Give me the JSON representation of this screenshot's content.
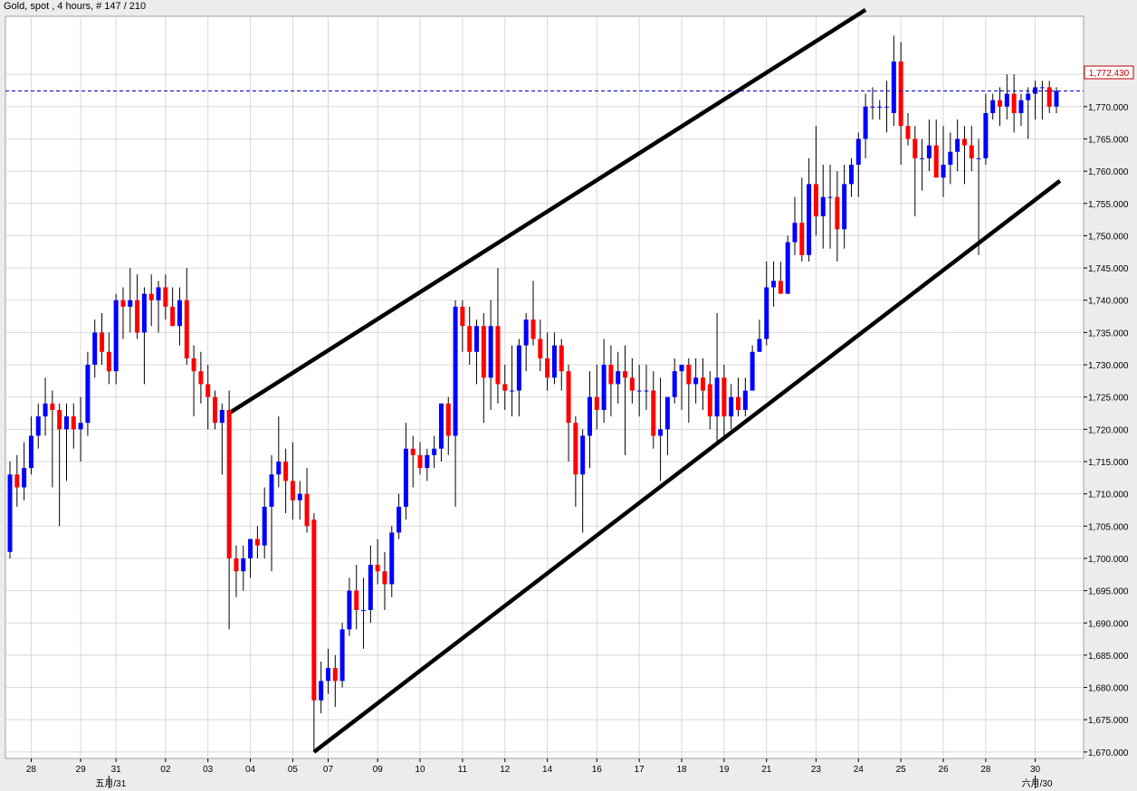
{
  "header": {
    "title": "Gold, spot , 4 hours, # 147 / 210"
  },
  "colors": {
    "up": "#0000ff",
    "down": "#ff0000",
    "grid": "#d8d8d8",
    "channel": "#000000",
    "last_price_line": "#0000cc",
    "last_price_label": "#c00000"
  },
  "chart_data": {
    "type": "candlestick",
    "ylim": [
      1669,
      1784
    ],
    "yticks": [
      1670,
      1675,
      1680,
      1685,
      1690,
      1695,
      1700,
      1705,
      1710,
      1715,
      1720,
      1725,
      1730,
      1735,
      1740,
      1745,
      1750,
      1755,
      1760,
      1765,
      1770,
      1775
    ],
    "xticks": [
      {
        "label": "28",
        "i": 3
      },
      {
        "label": "29",
        "i": 10
      },
      {
        "label": "31",
        "i": 15
      },
      {
        "label": "02",
        "i": 22
      },
      {
        "label": "03",
        "i": 28
      },
      {
        "label": "04",
        "i": 34
      },
      {
        "label": "05",
        "i": 40
      },
      {
        "label": "07",
        "i": 45
      },
      {
        "label": "09",
        "i": 52
      },
      {
        "label": "10",
        "i": 58
      },
      {
        "label": "11",
        "i": 64
      },
      {
        "label": "12",
        "i": 70
      },
      {
        "label": "14",
        "i": 76
      },
      {
        "label": "16",
        "i": 83
      },
      {
        "label": "17",
        "i": 89
      },
      {
        "label": "18",
        "i": 95
      },
      {
        "label": "19",
        "i": 101
      },
      {
        "label": "21",
        "i": 107
      },
      {
        "label": "23",
        "i": 114
      },
      {
        "label": "24",
        "i": 120
      },
      {
        "label": "25",
        "i": 126
      },
      {
        "label": "26",
        "i": 132
      },
      {
        "label": "28",
        "i": 138
      },
      {
        "label": "30",
        "i": 145
      }
    ],
    "month_labels": [
      {
        "label": "五月/31",
        "i": 14
      },
      {
        "label": "六月/30",
        "i": 145
      }
    ],
    "last_price": 1772.43,
    "last_price_label": "1,772.430",
    "trendlines": [
      {
        "name": "upper-channel-line",
        "from": {
          "i": 31,
          "y": 1722.5
        },
        "to": {
          "i": 121,
          "y": 1785
        }
      },
      {
        "name": "lower-channel-line",
        "from": {
          "i": 43,
          "y": 1670
        },
        "to": {
          "i": 148.5,
          "y": 1758.5
        }
      }
    ],
    "candles": [
      {
        "o": 1701,
        "h": 1715,
        "l": 1700,
        "c": 1713
      },
      {
        "o": 1713,
        "h": 1716,
        "l": 1708,
        "c": 1711
      },
      {
        "o": 1711,
        "h": 1718,
        "l": 1709,
        "c": 1714
      },
      {
        "o": 1714,
        "h": 1722,
        "l": 1713,
        "c": 1719
      },
      {
        "o": 1719,
        "h": 1724,
        "l": 1717,
        "c": 1722
      },
      {
        "o": 1722,
        "h": 1728,
        "l": 1719,
        "c": 1724
      },
      {
        "o": 1724,
        "h": 1726,
        "l": 1711,
        "c": 1723
      },
      {
        "o": 1723,
        "h": 1724,
        "l": 1705,
        "c": 1720
      },
      {
        "o": 1720,
        "h": 1724,
        "l": 1712,
        "c": 1722
      },
      {
        "o": 1722,
        "h": 1724,
        "l": 1717,
        "c": 1720
      },
      {
        "o": 1720,
        "h": 1725,
        "l": 1715,
        "c": 1721
      },
      {
        "o": 1721,
        "h": 1732,
        "l": 1719,
        "c": 1730
      },
      {
        "o": 1730,
        "h": 1737,
        "l": 1728,
        "c": 1735
      },
      {
        "o": 1735,
        "h": 1738,
        "l": 1730,
        "c": 1732
      },
      {
        "o": 1732,
        "h": 1735,
        "l": 1727,
        "c": 1729
      },
      {
        "o": 1729,
        "h": 1741,
        "l": 1727,
        "c": 1740
      },
      {
        "o": 1740,
        "h": 1742,
        "l": 1734,
        "c": 1739
      },
      {
        "o": 1739,
        "h": 1745,
        "l": 1735,
        "c": 1740
      },
      {
        "o": 1740,
        "h": 1744,
        "l": 1734,
        "c": 1735
      },
      {
        "o": 1735,
        "h": 1742,
        "l": 1727,
        "c": 1741
      },
      {
        "o": 1741,
        "h": 1744,
        "l": 1736,
        "c": 1740
      },
      {
        "o": 1740,
        "h": 1743,
        "l": 1735,
        "c": 1742
      },
      {
        "o": 1742,
        "h": 1744,
        "l": 1737,
        "c": 1739
      },
      {
        "o": 1739,
        "h": 1742,
        "l": 1736,
        "c": 1736
      },
      {
        "o": 1736,
        "h": 1742,
        "l": 1733,
        "c": 1740
      },
      {
        "o": 1740,
        "h": 1745,
        "l": 1730,
        "c": 1731
      },
      {
        "o": 1731,
        "h": 1733,
        "l": 1722,
        "c": 1729
      },
      {
        "o": 1729,
        "h": 1732,
        "l": 1724,
        "c": 1727
      },
      {
        "o": 1727,
        "h": 1730,
        "l": 1720,
        "c": 1725
      },
      {
        "o": 1725,
        "h": 1726,
        "l": 1720,
        "c": 1721
      },
      {
        "o": 1721,
        "h": 1724,
        "l": 1713,
        "c": 1723
      },
      {
        "o": 1723,
        "h": 1726,
        "l": 1689,
        "c": 1700
      },
      {
        "o": 1700,
        "h": 1702,
        "l": 1694,
        "c": 1698
      },
      {
        "o": 1698,
        "h": 1702,
        "l": 1695,
        "c": 1700
      },
      {
        "o": 1700,
        "h": 1703,
        "l": 1697,
        "c": 1703
      },
      {
        "o": 1703,
        "h": 1705,
        "l": 1700,
        "c": 1702
      },
      {
        "o": 1702,
        "h": 1711,
        "l": 1700,
        "c": 1708
      },
      {
        "o": 1708,
        "h": 1716,
        "l": 1698,
        "c": 1713
      },
      {
        "o": 1713,
        "h": 1722,
        "l": 1711,
        "c": 1715
      },
      {
        "o": 1715,
        "h": 1717,
        "l": 1707,
        "c": 1712
      },
      {
        "o": 1712,
        "h": 1718,
        "l": 1706,
        "c": 1709
      },
      {
        "o": 1709,
        "h": 1712,
        "l": 1706,
        "c": 1710
      },
      {
        "o": 1710,
        "h": 1714,
        "l": 1704,
        "c": 1705
      },
      {
        "o": 1706,
        "h": 1707,
        "l": 1670,
        "c": 1678
      },
      {
        "o": 1678,
        "h": 1684,
        "l": 1676,
        "c": 1681
      },
      {
        "o": 1681,
        "h": 1686,
        "l": 1679,
        "c": 1683
      },
      {
        "o": 1683,
        "h": 1685,
        "l": 1677,
        "c": 1681
      },
      {
        "o": 1681,
        "h": 1690,
        "l": 1680,
        "c": 1689
      },
      {
        "o": 1689,
        "h": 1697,
        "l": 1688,
        "c": 1695
      },
      {
        "o": 1695,
        "h": 1699,
        "l": 1689,
        "c": 1692
      },
      {
        "o": 1692,
        "h": 1697,
        "l": 1686,
        "c": 1692
      },
      {
        "o": 1692,
        "h": 1702,
        "l": 1690,
        "c": 1699
      },
      {
        "o": 1699,
        "h": 1703,
        "l": 1696,
        "c": 1698
      },
      {
        "o": 1698,
        "h": 1701,
        "l": 1692,
        "c": 1696
      },
      {
        "o": 1696,
        "h": 1705,
        "l": 1694,
        "c": 1704
      },
      {
        "o": 1704,
        "h": 1710,
        "l": 1703,
        "c": 1708
      },
      {
        "o": 1708,
        "h": 1721,
        "l": 1706,
        "c": 1717
      },
      {
        "o": 1717,
        "h": 1719,
        "l": 1711,
        "c": 1716
      },
      {
        "o": 1716,
        "h": 1718,
        "l": 1713,
        "c": 1714
      },
      {
        "o": 1714,
        "h": 1717,
        "l": 1712,
        "c": 1716
      },
      {
        "o": 1716,
        "h": 1719,
        "l": 1714,
        "c": 1717
      },
      {
        "o": 1717,
        "h": 1724,
        "l": 1715,
        "c": 1724
      },
      {
        "o": 1724,
        "h": 1725,
        "l": 1716,
        "c": 1719
      },
      {
        "o": 1719,
        "h": 1740,
        "l": 1708,
        "c": 1739
      },
      {
        "o": 1739,
        "h": 1740,
        "l": 1732,
        "c": 1736
      },
      {
        "o": 1736,
        "h": 1739,
        "l": 1730,
        "c": 1732
      },
      {
        "o": 1732,
        "h": 1737,
        "l": 1727,
        "c": 1736
      },
      {
        "o": 1736,
        "h": 1738,
        "l": 1721,
        "c": 1728
      },
      {
        "o": 1728,
        "h": 1740,
        "l": 1723,
        "c": 1736
      },
      {
        "o": 1736,
        "h": 1745,
        "l": 1724,
        "c": 1727
      },
      {
        "o": 1727,
        "h": 1730,
        "l": 1723,
        "c": 1726
      },
      {
        "o": 1726,
        "h": 1733,
        "l": 1722,
        "c": 1726
      },
      {
        "o": 1726,
        "h": 1734,
        "l": 1722,
        "c": 1733
      },
      {
        "o": 1733,
        "h": 1738,
        "l": 1729,
        "c": 1737
      },
      {
        "o": 1737,
        "h": 1743,
        "l": 1733,
        "c": 1734
      },
      {
        "o": 1734,
        "h": 1737,
        "l": 1729,
        "c": 1731
      },
      {
        "o": 1731,
        "h": 1735,
        "l": 1726,
        "c": 1728
      },
      {
        "o": 1728,
        "h": 1735,
        "l": 1727,
        "c": 1733
      },
      {
        "o": 1733,
        "h": 1734,
        "l": 1726,
        "c": 1729
      },
      {
        "o": 1729,
        "h": 1730,
        "l": 1715,
        "c": 1721
      },
      {
        "o": 1721,
        "h": 1722,
        "l": 1708,
        "c": 1713
      },
      {
        "o": 1713,
        "h": 1720,
        "l": 1704,
        "c": 1719
      },
      {
        "o": 1719,
        "h": 1729,
        "l": 1714,
        "c": 1725
      },
      {
        "o": 1725,
        "h": 1730,
        "l": 1720,
        "c": 1723
      },
      {
        "o": 1723,
        "h": 1734,
        "l": 1721,
        "c": 1730
      },
      {
        "o": 1730,
        "h": 1733,
        "l": 1722,
        "c": 1727
      },
      {
        "o": 1727,
        "h": 1732,
        "l": 1724,
        "c": 1729
      },
      {
        "o": 1729,
        "h": 1733,
        "l": 1716,
        "c": 1728
      },
      {
        "o": 1728,
        "h": 1731,
        "l": 1724,
        "c": 1726
      },
      {
        "o": 1726,
        "h": 1730,
        "l": 1722,
        "c": 1726
      },
      {
        "o": 1726,
        "h": 1730,
        "l": 1723,
        "c": 1726
      },
      {
        "o": 1726,
        "h": 1729,
        "l": 1717,
        "c": 1719
      },
      {
        "o": 1719,
        "h": 1728,
        "l": 1712,
        "c": 1720
      },
      {
        "o": 1720,
        "h": 1725,
        "l": 1716,
        "c": 1725
      },
      {
        "o": 1725,
        "h": 1731,
        "l": 1724,
        "c": 1729
      },
      {
        "o": 1729,
        "h": 1730,
        "l": 1723,
        "c": 1730
      },
      {
        "o": 1730,
        "h": 1731,
        "l": 1721,
        "c": 1727
      },
      {
        "o": 1727,
        "h": 1731,
        "l": 1724,
        "c": 1728
      },
      {
        "o": 1728,
        "h": 1731,
        "l": 1723,
        "c": 1726
      },
      {
        "o": 1727,
        "h": 1729,
        "l": 1720,
        "c": 1722
      },
      {
        "o": 1722,
        "h": 1738,
        "l": 1718,
        "c": 1728
      },
      {
        "o": 1728,
        "h": 1730,
        "l": 1719,
        "c": 1722
      },
      {
        "o": 1722,
        "h": 1727,
        "l": 1720,
        "c": 1725
      },
      {
        "o": 1725,
        "h": 1728,
        "l": 1722,
        "c": 1723
      },
      {
        "o": 1723,
        "h": 1728,
        "l": 1722,
        "c": 1726
      },
      {
        "o": 1726,
        "h": 1733,
        "l": 1726,
        "c": 1732
      },
      {
        "o": 1732,
        "h": 1737,
        "l": 1732,
        "c": 1734
      },
      {
        "o": 1734,
        "h": 1746,
        "l": 1733,
        "c": 1742
      },
      {
        "o": 1742,
        "h": 1746,
        "l": 1739,
        "c": 1743
      },
      {
        "o": 1743,
        "h": 1746,
        "l": 1742,
        "c": 1741
      },
      {
        "o": 1741,
        "h": 1750,
        "l": 1741,
        "c": 1749
      },
      {
        "o": 1749,
        "h": 1756,
        "l": 1747,
        "c": 1752
      },
      {
        "o": 1752,
        "h": 1759,
        "l": 1746,
        "c": 1747
      },
      {
        "o": 1747,
        "h": 1762,
        "l": 1746,
        "c": 1758
      },
      {
        "o": 1758,
        "h": 1767,
        "l": 1750,
        "c": 1753
      },
      {
        "o": 1753,
        "h": 1761,
        "l": 1748,
        "c": 1756
      },
      {
        "o": 1756,
        "h": 1761,
        "l": 1748,
        "c": 1756
      },
      {
        "o": 1756,
        "h": 1760,
        "l": 1746,
        "c": 1751
      },
      {
        "o": 1751,
        "h": 1761,
        "l": 1748,
        "c": 1758
      },
      {
        "o": 1758,
        "h": 1762,
        "l": 1756,
        "c": 1761
      },
      {
        "o": 1761,
        "h": 1766,
        "l": 1756,
        "c": 1765
      },
      {
        "o": 1765,
        "h": 1772,
        "l": 1762,
        "c": 1770
      },
      {
        "o": 1770,
        "h": 1773,
        "l": 1768,
        "c": 1770
      },
      {
        "o": 1770,
        "h": 1771,
        "l": 1768,
        "c": 1770
      },
      {
        "o": 1770,
        "h": 1774,
        "l": 1766,
        "c": 1770
      },
      {
        "o": 1769,
        "h": 1781,
        "l": 1767,
        "c": 1777
      },
      {
        "o": 1777,
        "h": 1780,
        "l": 1761,
        "c": 1767
      },
      {
        "o": 1767,
        "h": 1769,
        "l": 1764,
        "c": 1765
      },
      {
        "o": 1765,
        "h": 1767,
        "l": 1753,
        "c": 1762
      },
      {
        "o": 1762,
        "h": 1765,
        "l": 1757,
        "c": 1762
      },
      {
        "o": 1762,
        "h": 1768,
        "l": 1760,
        "c": 1764
      },
      {
        "o": 1764,
        "h": 1768,
        "l": 1760,
        "c": 1759
      },
      {
        "o": 1759,
        "h": 1767,
        "l": 1756,
        "c": 1761
      },
      {
        "o": 1761,
        "h": 1766,
        "l": 1758,
        "c": 1763
      },
      {
        "o": 1763,
        "h": 1768,
        "l": 1760,
        "c": 1765
      },
      {
        "o": 1765,
        "h": 1767,
        "l": 1758,
        "c": 1764
      },
      {
        "o": 1764,
        "h": 1767,
        "l": 1760,
        "c": 1762
      },
      {
        "o": 1762,
        "h": 1765,
        "l": 1747,
        "c": 1762
      },
      {
        "o": 1762,
        "h": 1772,
        "l": 1761,
        "c": 1769
      },
      {
        "o": 1769,
        "h": 1772,
        "l": 1768,
        "c": 1771
      },
      {
        "o": 1771,
        "h": 1773,
        "l": 1767,
        "c": 1770
      },
      {
        "o": 1770,
        "h": 1775,
        "l": 1768,
        "c": 1772
      },
      {
        "o": 1772,
        "h": 1775,
        "l": 1766,
        "c": 1769
      },
      {
        "o": 1769,
        "h": 1772,
        "l": 1767,
        "c": 1771
      },
      {
        "o": 1771,
        "h": 1773,
        "l": 1765,
        "c": 1772
      },
      {
        "o": 1772,
        "h": 1774,
        "l": 1768,
        "c": 1773
      },
      {
        "o": 1773,
        "h": 1774,
        "l": 1768,
        "c": 1773
      },
      {
        "o": 1773,
        "h": 1774,
        "l": 1769,
        "c": 1770
      },
      {
        "o": 1770,
        "h": 1773,
        "l": 1769,
        "c": 1772.43
      }
    ]
  }
}
